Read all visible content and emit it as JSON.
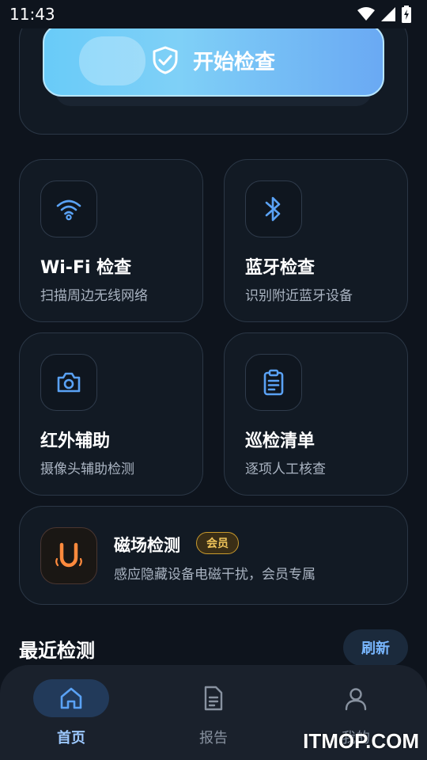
{
  "status_bar": {
    "time": "11:43",
    "icons": [
      "wifi-icon",
      "signal-icon",
      "battery-charging-icon"
    ]
  },
  "hero": {
    "start_label": "开始检查",
    "icon": "shield-check-icon"
  },
  "tiles": [
    {
      "title": "Wi-Fi 检查",
      "desc": "扫描周边无线网络",
      "icon": "wifi-icon"
    },
    {
      "title": "蓝牙检查",
      "desc": "识别附近蓝牙设备",
      "icon": "bluetooth-icon"
    },
    {
      "title": "红外辅助",
      "desc": "摄像头辅助检测",
      "icon": "camera-icon"
    },
    {
      "title": "巡检清单",
      "desc": "逐项人工核查",
      "icon": "clipboard-icon"
    }
  ],
  "magnet": {
    "title": "磁场检测",
    "badge": "会员",
    "desc": "感应隐藏设备电磁干扰，会员专属",
    "icon": "magnet-icon"
  },
  "recent": {
    "title": "最近检测",
    "refresh_label": "刷新"
  },
  "nav": [
    {
      "label": "首页",
      "icon": "home-icon",
      "active": true
    },
    {
      "label": "报告",
      "icon": "report-icon",
      "active": false
    },
    {
      "label": "我的",
      "icon": "profile-icon",
      "active": false
    }
  ],
  "watermark": "ITMOP.COM",
  "colors": {
    "accent": "#5aa2f5",
    "hero_gradient_start": "#69cbf8",
    "vip_gold": "#f0c45a",
    "magnet_orange": "#ff8a3d"
  }
}
